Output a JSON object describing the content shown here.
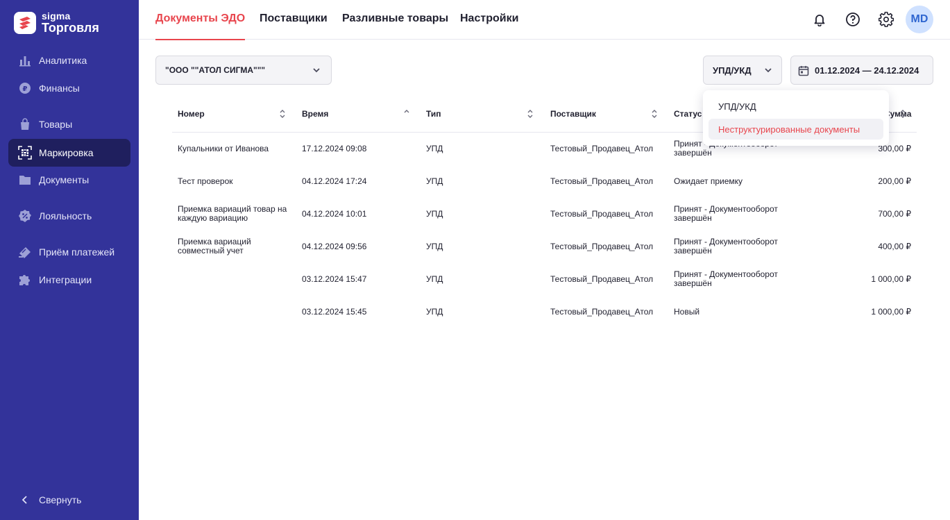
{
  "brand": {
    "sub": "sigma",
    "name": "Торговля"
  },
  "sidebar": {
    "items": [
      {
        "label": "Аналитика",
        "icon": "bar-chart-icon"
      },
      {
        "label": "Финансы",
        "icon": "ruble-coin-icon"
      },
      {
        "label": "Товары",
        "icon": "shopping-bag-icon"
      },
      {
        "label": "Маркировка",
        "icon": "datamatrix-scan-icon",
        "active": true
      },
      {
        "label": "Документы",
        "icon": "folder-icon"
      },
      {
        "label": "Лояльность",
        "icon": "discount-badge-icon"
      },
      {
        "label": "Приём платежей",
        "icon": "payment-card-icon"
      },
      {
        "label": "Интеграции",
        "icon": "puzzle-icon"
      }
    ],
    "collapse_label": "Свернуть"
  },
  "header": {
    "tabs": [
      {
        "label": "Документы ЭДО",
        "active": true
      },
      {
        "label": "Поставщики"
      },
      {
        "label": "Разливные товары"
      },
      {
        "label": "Настройки"
      }
    ],
    "avatar_initials": "MD"
  },
  "filters": {
    "organization": "\"ООО \"\"АТОЛ СИГМА\"\"\"",
    "doc_type": "УПД/УКД",
    "date_range": "01.12.2024 — 24.12.2024"
  },
  "dropdown": {
    "options": [
      "УПД/УКД",
      "Неструктурированные документы"
    ],
    "highlighted": "Неструктурированные документы"
  },
  "table": {
    "columns": [
      "Номер",
      "Время",
      "Тип",
      "Поставщик",
      "Статус",
      "Сумма"
    ],
    "rows": [
      {
        "number": "Купальники от Иванова",
        "time": "17.12.2024 09:08",
        "type": "УПД",
        "supplier": "Тестовый_Продавец_Атол",
        "status": "Принят - Документооборот завершён",
        "amount": "300,00 ₽"
      },
      {
        "number": "Тест проверок",
        "time": "04.12.2024 17:24",
        "type": "УПД",
        "supplier": "Тестовый_Продавец_Атол",
        "status": "Ожидает приемку",
        "amount": "200,00 ₽"
      },
      {
        "number": "Приемка вариаций товар на каждую вариацию",
        "time": "04.12.2024 10:01",
        "type": "УПД",
        "supplier": "Тестовый_Продавец_Атол",
        "status": "Принят - Документооборот завершён",
        "amount": "700,00 ₽"
      },
      {
        "number": "Приемка вариаций совместный учет",
        "time": "04.12.2024 09:56",
        "type": "УПД",
        "supplier": "Тестовый_Продавец_Атол",
        "status": "Принят - Документооборот завершён",
        "amount": "400,00 ₽"
      },
      {
        "number": "",
        "time": "03.12.2024 15:47",
        "type": "УПД",
        "supplier": "Тестовый_Продавец_Атол",
        "status": "Принят - Документооборот завершён",
        "amount": "1 000,00 ₽"
      },
      {
        "number": "",
        "time": "03.12.2024 15:45",
        "type": "УПД",
        "supplier": "Тестовый_Продавец_Атол",
        "status": "Новый",
        "amount": "1 000,00 ₽"
      }
    ]
  },
  "colors": {
    "sidebar_bg": "#33339a",
    "sidebar_active": "#1f1f5e",
    "accent": "#e8454d",
    "avatar_bg": "#cfe1ff"
  }
}
